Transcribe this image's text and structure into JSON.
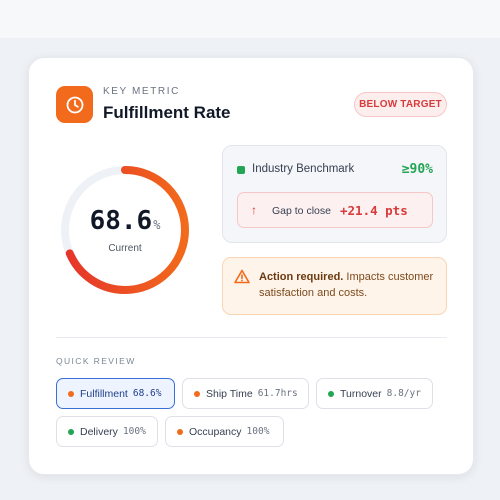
{
  "header": {
    "eyebrow": "KEY METRIC",
    "title": "Fulfillment Rate",
    "status_badge": "BELOW TARGET",
    "icon": "clock-icon"
  },
  "gauge": {
    "value": "68.6",
    "unit": "%",
    "label": "Current",
    "fraction": 0.686
  },
  "benchmark": {
    "label": "Industry Benchmark",
    "value": "≥90%",
    "gap_label": "Gap to close",
    "gap_value": "+21.4 pts",
    "gap_icon": "arrow-up-icon"
  },
  "alert": {
    "icon": "warning-icon",
    "strong": "Action required.",
    "text": " Impacts customer satisfaction and costs."
  },
  "quick_review": {
    "label": "QUICK REVIEW",
    "chips": [
      {
        "label": "Fulfillment",
        "value": "68.6%",
        "active": true
      },
      {
        "label": "Ship Time",
        "value": "61.7hrs"
      },
      {
        "label": "Turnover",
        "value": "8.8/yr"
      },
      {
        "label": "Delivery",
        "value": "100%"
      },
      {
        "label": "Occupancy",
        "value": "100%"
      }
    ]
  },
  "colors": {
    "accent": "#f26a1b",
    "danger": "#d73b3b",
    "success": "#22a653",
    "active_chip": "#3b6fd8"
  }
}
